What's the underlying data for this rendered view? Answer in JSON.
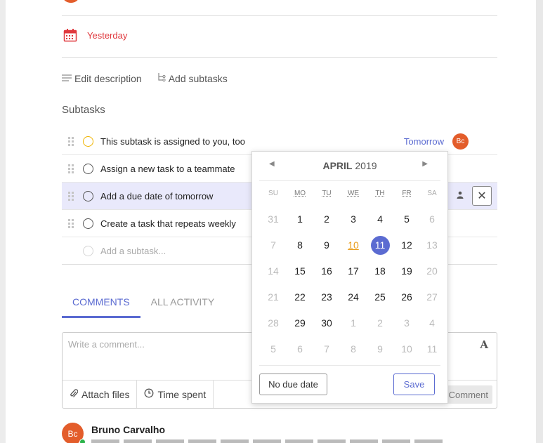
{
  "task": {
    "due_label": "Yesterday",
    "edit_description": "Edit description",
    "add_subtasks": "Add subtasks",
    "subtasks_title": "Subtasks"
  },
  "subtasks": [
    {
      "text": "This subtask is assigned to you, too",
      "due": "Tomorrow",
      "assignee": "Bc"
    },
    {
      "text": "Assign a new task to a teammate"
    },
    {
      "text": "Add a due date of tomorrow"
    },
    {
      "text": "Create a task that repeats weekly"
    }
  ],
  "add_subtask_placeholder": "Add a subtask...",
  "tabs": [
    "COMMENTS",
    "ALL ACTIVITY"
  ],
  "comment": {
    "placeholder": "Write a comment...",
    "font_icon": "A",
    "attach": "Attach files",
    "time": "Time spent",
    "submit": "Comment"
  },
  "author": {
    "initials": "Bc",
    "name": "Bruno Carvalho"
  },
  "calendar": {
    "month": "APRIL",
    "year": "2019",
    "weekdays": [
      "SU",
      "MO",
      "TU",
      "WE",
      "TH",
      "FR",
      "SA"
    ],
    "weeks": [
      [
        "31",
        "1",
        "2",
        "3",
        "4",
        "5",
        "6"
      ],
      [
        "7",
        "8",
        "9",
        "10",
        "11",
        "12",
        "13"
      ],
      [
        "14",
        "15",
        "16",
        "17",
        "18",
        "19",
        "20"
      ],
      [
        "21",
        "22",
        "23",
        "24",
        "25",
        "26",
        "27"
      ],
      [
        "28",
        "29",
        "30",
        "1",
        "2",
        "3",
        "4"
      ],
      [
        "5",
        "6",
        "7",
        "8",
        "9",
        "10",
        "11"
      ]
    ],
    "today": "10",
    "selected": "11",
    "no_due_label": "No due date",
    "save_label": "Save"
  },
  "colors": {
    "accent": "#5b6bd1",
    "overdue": "#e0393e",
    "avatar": "#e35d2b",
    "today": "#e89c1a"
  }
}
